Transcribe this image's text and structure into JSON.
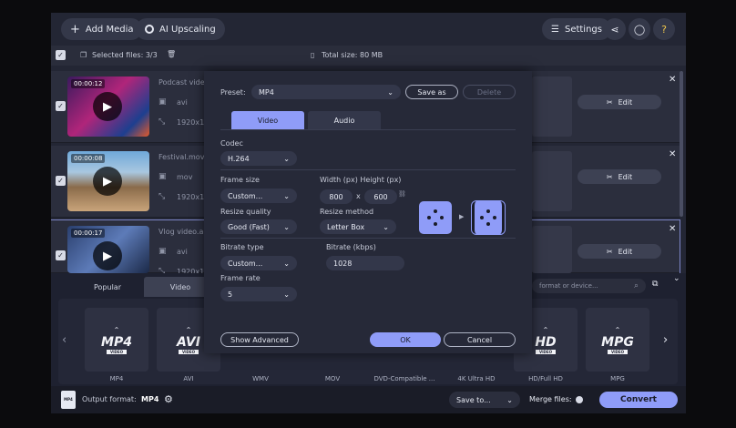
{
  "topbar": {
    "add_media": "Add Media",
    "ai_upscaling": "AI Upscaling",
    "settings": "Settings"
  },
  "filesbar": {
    "selected": "Selected files: 3/3",
    "total_size": "Total size: 80 MB"
  },
  "files": [
    {
      "time": "00:00:12",
      "name": "Podcast vide",
      "ext": "avi",
      "res": "1920x1",
      "edit": "Edit"
    },
    {
      "time": "00:00:08",
      "name": "Festival.mov",
      "ext": "mov",
      "res": "1920x10",
      "edit": "Edit"
    },
    {
      "time": "00:00:17",
      "name": "Vlog video.a",
      "ext": "avi",
      "res": "1920x1",
      "edit": "Edit"
    }
  ],
  "format_tabs": [
    "Popular",
    "Video"
  ],
  "format_search_placeholder": "format or device...",
  "formats": [
    {
      "logo": "MP4",
      "label": "MP4"
    },
    {
      "logo": "AVI",
      "label": "AVI"
    },
    {
      "logo": "",
      "label": "WMV"
    },
    {
      "logo": "",
      "label": "MOV"
    },
    {
      "logo": "",
      "label": "DVD-Compatible ..."
    },
    {
      "logo": "",
      "label": "4K Ultra HD"
    },
    {
      "logo": "HD",
      "label": "HD/Full HD"
    },
    {
      "logo": "MPG",
      "label": "MPG"
    }
  ],
  "footer": {
    "output_label": "Output format:",
    "output_value": "MP4",
    "save_to": "Save to...",
    "merge_files": "Merge files:",
    "convert": "Convert"
  },
  "modal": {
    "preset_label": "Preset:",
    "preset_value": "MP4",
    "save_as": "Save as",
    "delete": "Delete",
    "tab_video": "Video",
    "tab_audio": "Audio",
    "codec_label": "Codec",
    "codec_value": "H.264",
    "frame_size_label": "Frame size",
    "frame_size_value": "Custom...",
    "wh_label": "Width (px)  Height (px)",
    "width": "800",
    "x": "x",
    "height": "600",
    "resize_quality_label": "Resize quality",
    "resize_quality_value": "Good (Fast)",
    "resize_method_label": "Resize method",
    "resize_method_value": "Letter Box",
    "bitrate_type_label": "Bitrate type",
    "bitrate_type_value": "Custom...",
    "bitrate_label": "Bitrate (kbps)",
    "bitrate_value": "1028",
    "frame_rate_label": "Frame rate",
    "frame_rate_value": "5",
    "show_advanced": "Show Advanced",
    "ok": "OK",
    "cancel": "Cancel"
  },
  "colors": {
    "accent": "#8f9cf8",
    "background": "#232634"
  }
}
